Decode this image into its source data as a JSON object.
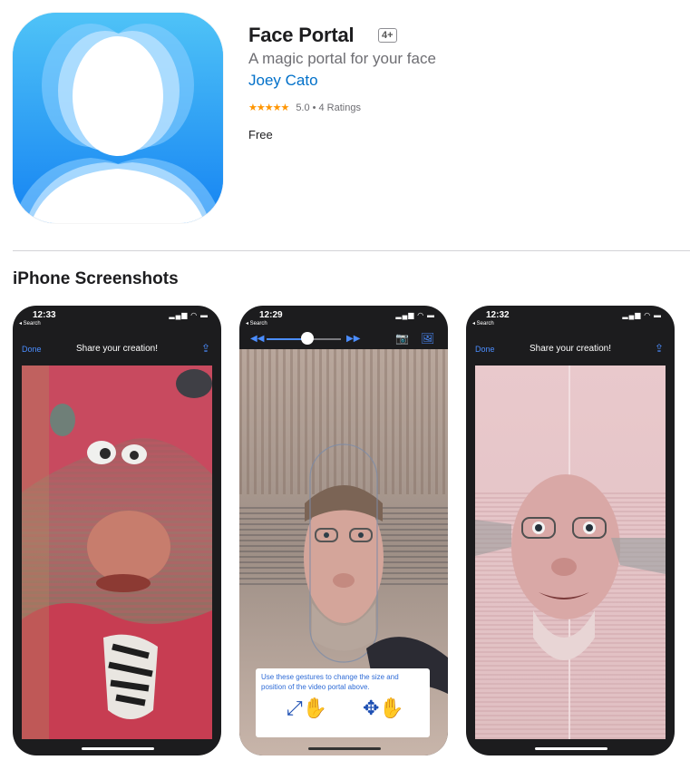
{
  "app": {
    "title": "Face Portal",
    "age_rating": "4+",
    "subtitle": "A magic portal for your face",
    "developer": "Joey Cato",
    "stars": "★★★★★",
    "rating_value": "5.0",
    "rating_separator": "•",
    "ratings_count": "4 Ratings",
    "price": "Free",
    "icon": "face-silhouette-icon"
  },
  "screenshots": {
    "section_title": "iPhone Screenshots",
    "items": [
      {
        "time": "12:33",
        "back": "◂ Search",
        "status_icons": "▂▄▆ ◠ ▬",
        "done": "Done",
        "title": "Share your creation!",
        "share": "⇪"
      },
      {
        "time": "12:29",
        "back": "◂ Search",
        "status_icons": "▂▄▆ ◠ ▬",
        "rewind": "◀◀",
        "fast_forward": "▶▶",
        "slider_value": 0.55,
        "camera": "📷",
        "image": "🖼",
        "hint": "Use these gestures to change the size and position of the video portal above."
      },
      {
        "time": "12:32",
        "back": "◂ Search",
        "status_icons": "▂▄▆ ◠ ▬",
        "done": "Done",
        "title": "Share your creation!",
        "share": "⇪"
      }
    ]
  },
  "colors": {
    "link": "#0070c9",
    "star": "#ff9500",
    "ios_blue": "#4b8dff"
  }
}
